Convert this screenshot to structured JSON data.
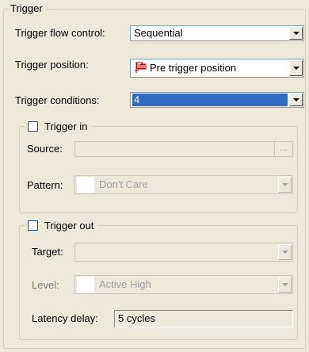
{
  "trigger": {
    "group_title": "Trigger",
    "flow_control": {
      "label": "Trigger flow control:",
      "value": "Sequential"
    },
    "position": {
      "label": "Trigger position:",
      "value": "Pre trigger position",
      "icon": "trigger-flag-icon"
    },
    "conditions": {
      "label": "Trigger conditions:",
      "value": "4"
    }
  },
  "trigger_in": {
    "title": "Trigger in",
    "checked": false,
    "source": {
      "label": "Source:",
      "value": "",
      "browse_label": "..."
    },
    "pattern": {
      "label": "Pattern:",
      "value": "Don't Care"
    }
  },
  "trigger_out": {
    "title": "Trigger out",
    "checked": false,
    "target": {
      "label": "Target:",
      "value": ""
    },
    "level": {
      "label": "Level:",
      "value": "Active High"
    },
    "latency": {
      "label": "Latency delay:",
      "value": "5 cycles"
    }
  },
  "colors": {
    "dialog_bg": "#ece9d8",
    "selection": "#316ac5",
    "disabled_text": "#a0a0a0"
  }
}
